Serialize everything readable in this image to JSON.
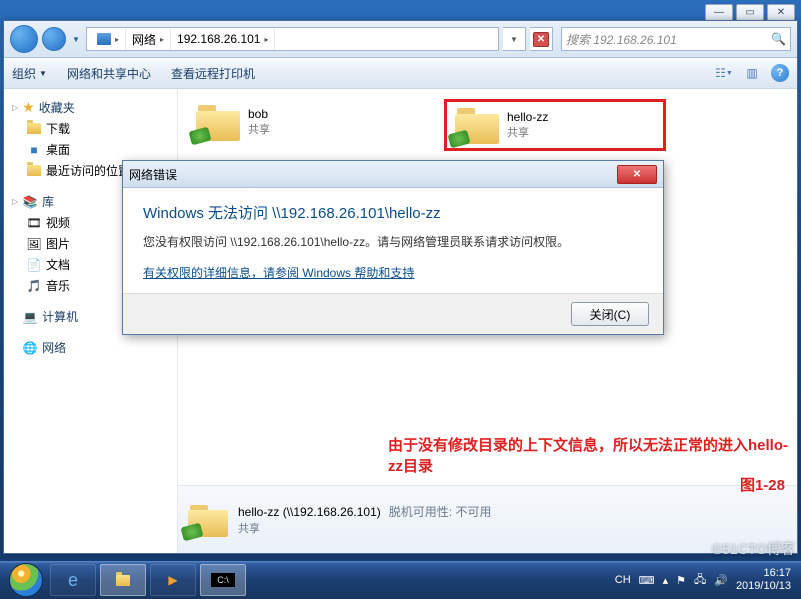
{
  "winctrl": {
    "min": "—",
    "max": "▭",
    "close": "✕"
  },
  "address": {
    "root": "网络",
    "ip": "192.168.26.101"
  },
  "search": {
    "placeholder": "搜索 192.168.26.101"
  },
  "toolbar": {
    "organize": "组织",
    "netshare": "网络和共享中心",
    "remoteprint": "查看远程打印机"
  },
  "sidebar": {
    "fav": {
      "label": "收藏夹",
      "items": [
        "下载",
        "桌面",
        "最近访问的位置"
      ]
    },
    "lib": {
      "label": "库",
      "items": [
        "视频",
        "图片",
        "文档",
        "音乐"
      ]
    },
    "computer": {
      "label": "计算机"
    },
    "network": {
      "label": "网络"
    }
  },
  "items": [
    {
      "name": "bob",
      "sub": "共享"
    },
    {
      "name": "hello-zz",
      "sub": "共享"
    }
  ],
  "dialog": {
    "title": "网络错误",
    "heading": "Windows 无法访问 \\\\192.168.26.101\\hello-zz",
    "body": "您没有权限访问 \\\\192.168.26.101\\hello-zz。请与网络管理员联系请求访问权限。",
    "link": "有关权限的详细信息，请参阅 Windows 帮助和支持",
    "close": "关闭(C)"
  },
  "details": {
    "name": "hello-zz",
    "path": "(\\\\192.168.26.101)",
    "offline": "脱机可用性:",
    "offline_val": "不可用",
    "sub": "共享"
  },
  "annotation": "由于没有修改目录的上下文信息，所以无法正常的进入hello-zz目录",
  "figlabel": "图1-28",
  "tray": {
    "ime": "CH",
    "kb": "⌨",
    "time": "16:17",
    "date": "2019/10/13"
  },
  "watermark": "©51CTO博客"
}
